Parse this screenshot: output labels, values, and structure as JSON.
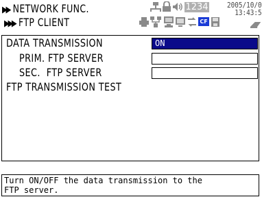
{
  "header": {
    "crumb1_arrows": "▶▶",
    "crumb1": "NETWORK FUNC.",
    "crumb2_arrows": "▶▶▶",
    "crumb2": "FTP CLIENT",
    "mem_counter": "1234",
    "date": "2005/10/0",
    "time": "13:43:5",
    "cf_label": "CF"
  },
  "menu": {
    "data_transmission_label": "DATA TRANSMISSION",
    "data_transmission_value": "ON",
    "prim_ftp_label": "PRIM. FTP SERVER",
    "prim_ftp_value": "",
    "sec_ftp_label": "SEC.  FTP SERVER",
    "sec_ftp_value": "",
    "ftp_test_label": "FTP TRANSMISSION TEST"
  },
  "help": {
    "line1": "Turn ON/OFF the data transmission to the",
    "line2": "FTP server."
  },
  "colors": {
    "selected_bg": "#0a0a8a",
    "icon_gray": "#8a8a8a",
    "icon_blue": "#1a3bd6"
  }
}
